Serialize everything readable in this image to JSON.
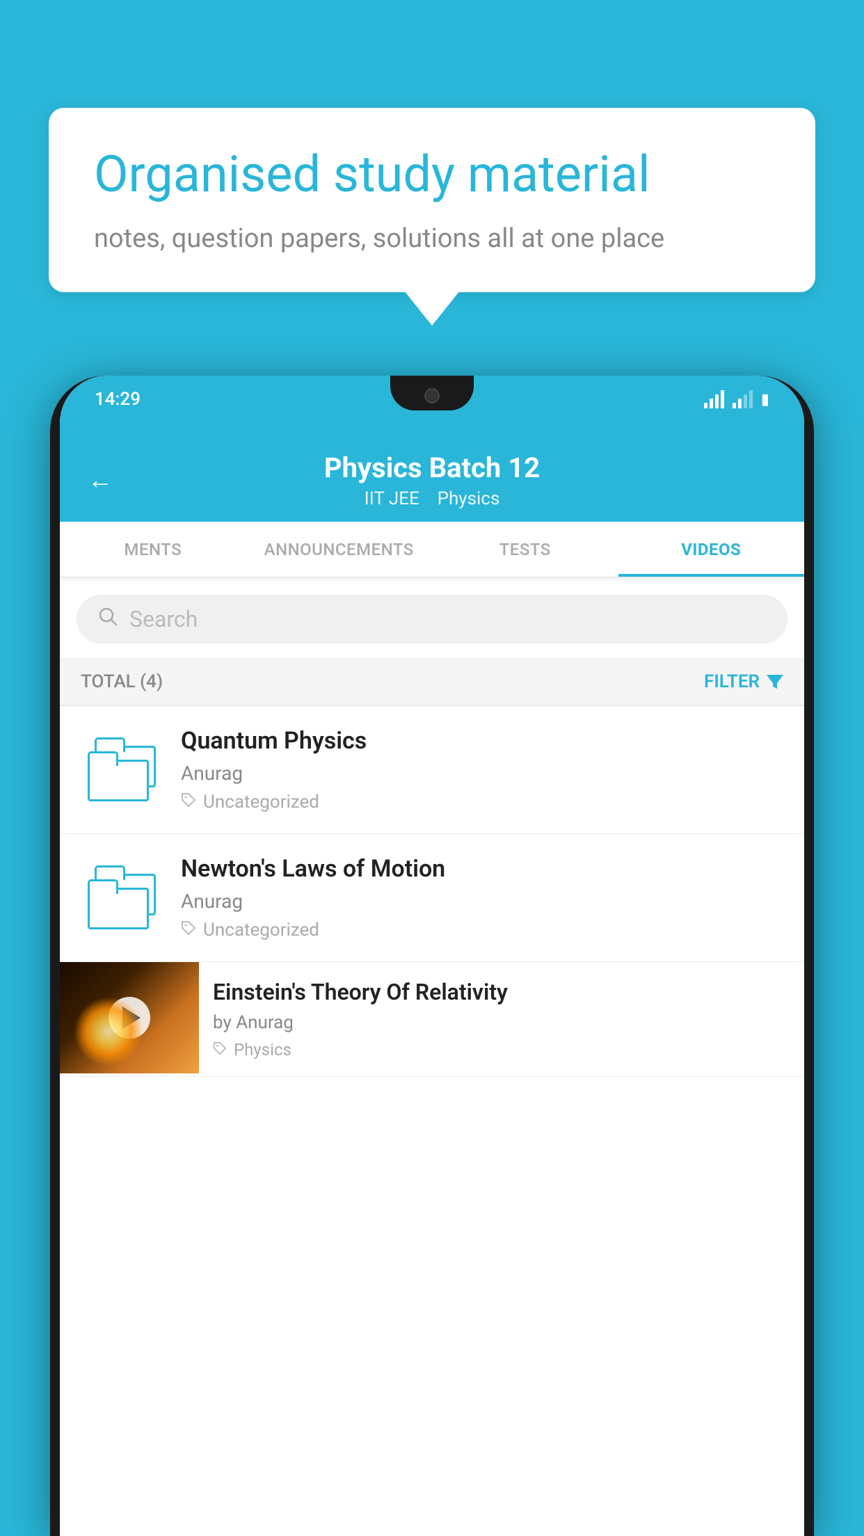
{
  "background_color": "#29B6D8",
  "speech_bubble": {
    "headline": "Organised study material",
    "subtext": "notes, question papers, solutions all at one place"
  },
  "phone": {
    "status_bar": {
      "time": "14:29",
      "wifi": "▾",
      "signal": "▲",
      "battery": "▮"
    },
    "header": {
      "title": "Physics Batch 12",
      "subtitle_part1": "IIT JEE",
      "subtitle_part2": "Physics",
      "back_label": "←"
    },
    "tabs": [
      {
        "label": "MENTS",
        "active": false
      },
      {
        "label": "ANNOUNCEMENTS",
        "active": false
      },
      {
        "label": "TESTS",
        "active": false
      },
      {
        "label": "VIDEOS",
        "active": true
      }
    ],
    "search": {
      "placeholder": "Search"
    },
    "filter": {
      "total_label": "TOTAL (4)",
      "filter_label": "FILTER"
    },
    "videos": [
      {
        "id": 1,
        "title": "Quantum Physics",
        "author": "Anurag",
        "tag": "Uncategorized",
        "type": "folder"
      },
      {
        "id": 2,
        "title": "Newton's Laws of Motion",
        "author": "Anurag",
        "tag": "Uncategorized",
        "type": "folder"
      },
      {
        "id": 3,
        "title": "Einstein's Theory Of Relativity",
        "author": "by Anurag",
        "tag": "Physics",
        "type": "video"
      }
    ]
  }
}
